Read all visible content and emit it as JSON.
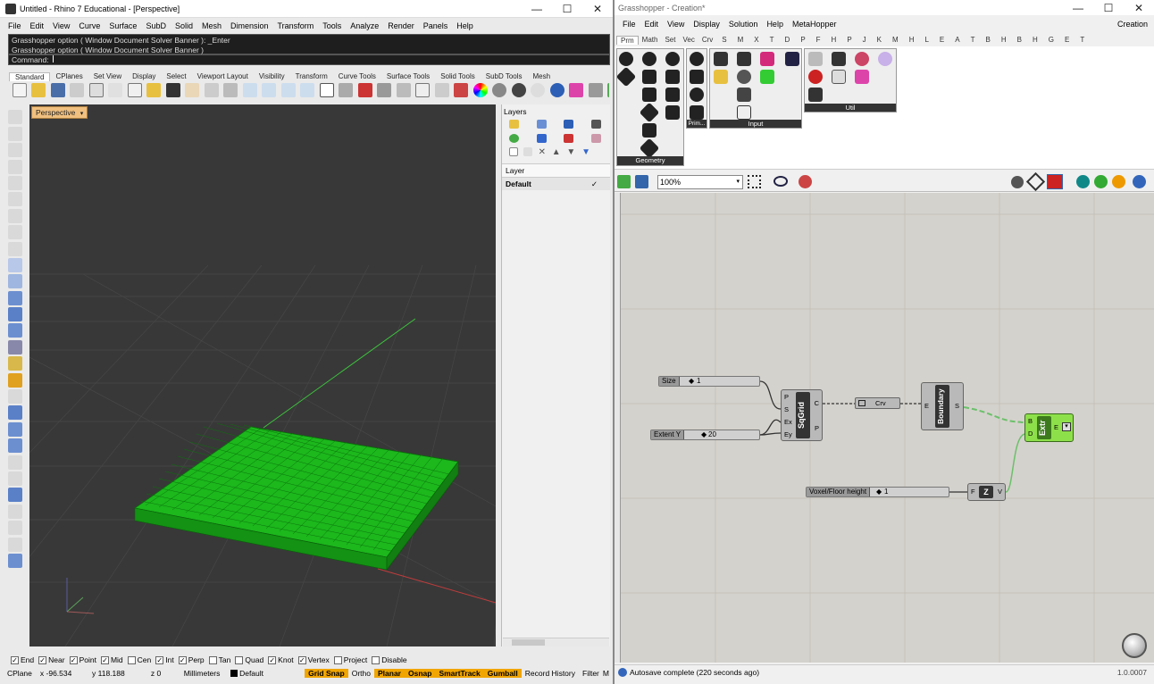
{
  "rhino": {
    "title": "Untitled - Rhino 7 Educational - [Perspective]",
    "menu": [
      "File",
      "Edit",
      "View",
      "Curve",
      "Surface",
      "SubD",
      "Solid",
      "Mesh",
      "Dimension",
      "Transform",
      "Tools",
      "Analyze",
      "Render",
      "Panels",
      "Help"
    ],
    "history": [
      "Grasshopper option ( Window  Document  Solver  Banner ): _Enter",
      "Grasshopper option ( Window  Document  Solver  Banner )"
    ],
    "command_label": "Command:",
    "toolbar_tabs": [
      "Standard",
      "CPlanes",
      "Set View",
      "Display",
      "Select",
      "Viewport Layout",
      "Visibility",
      "Transform",
      "Curve Tools",
      "Surface Tools",
      "Solid Tools",
      "SubD Tools",
      "Mesh"
    ],
    "viewport_label": "Perspective",
    "layers": {
      "title": "Layers",
      "col_header": "Layer",
      "default_layer": "Default"
    },
    "osnaps": [
      {
        "label": "End",
        "on": true
      },
      {
        "label": "Near",
        "on": true
      },
      {
        "label": "Point",
        "on": true
      },
      {
        "label": "Mid",
        "on": true
      },
      {
        "label": "Cen",
        "on": false
      },
      {
        "label": "Int",
        "on": true
      },
      {
        "label": "Perp",
        "on": true
      },
      {
        "label": "Tan",
        "on": false
      },
      {
        "label": "Quad",
        "on": false
      },
      {
        "label": "Knot",
        "on": true
      },
      {
        "label": "Vertex",
        "on": true
      },
      {
        "label": "Project",
        "on": false
      },
      {
        "label": "Disable",
        "on": false
      }
    ],
    "status": {
      "cplane": "CPlane",
      "x": "x -96.534",
      "y": "y 118.188",
      "z": "z 0",
      "units": "Millimeters",
      "layer": "Default",
      "grid_snap": "Grid Snap",
      "ortho": "Ortho",
      "planar": "Planar",
      "osnap": "Osnap",
      "smarttrack": "SmartTrack",
      "gumball": "Gumball",
      "record_history": "Record History",
      "filter": "Filter",
      "monitor": "M"
    }
  },
  "gh": {
    "title": "Grasshopper - Creation*",
    "menu": [
      "File",
      "Edit",
      "View",
      "Display",
      "Solution",
      "Help",
      "MetaHopper"
    ],
    "doc_name": "Creation",
    "tabs": [
      "Prm",
      "Math",
      "Set",
      "Vec",
      "Crv",
      "S",
      "M",
      "X",
      "T",
      "D",
      "P",
      "F",
      "H",
      "P",
      "J",
      "K",
      "M",
      "H",
      "L",
      "E",
      "A",
      "T",
      "B",
      "H",
      "B",
      "H",
      "G",
      "E",
      "T"
    ],
    "groups": {
      "geometry": "Geometry",
      "prim": "Prim...",
      "input": "Input",
      "util": "Util"
    },
    "zoom": "100%",
    "nodes": {
      "size_slider": {
        "label": "Size",
        "value": "1"
      },
      "extent_slider": {
        "label": "Extent Y",
        "value": "20"
      },
      "floor_slider": {
        "label": "Voxel/Floor height",
        "value": "1"
      },
      "sqgrid": {
        "name": "SqGrid",
        "inputs": [
          "P",
          "S",
          "Ex",
          "Ey"
        ],
        "outputs": [
          "C",
          "P"
        ]
      },
      "crv": {
        "name": "Crv"
      },
      "boundary": {
        "name": "Boundary",
        "input": "E",
        "output": "S"
      },
      "extr": {
        "name": "Extr",
        "inputs": [
          "B",
          "D"
        ],
        "output": "E"
      },
      "unitz": {
        "name": "Z",
        "input": "F",
        "output": "V"
      }
    },
    "status_msg": "Autosave complete (220 seconds ago)",
    "version": "1.0.0007"
  }
}
